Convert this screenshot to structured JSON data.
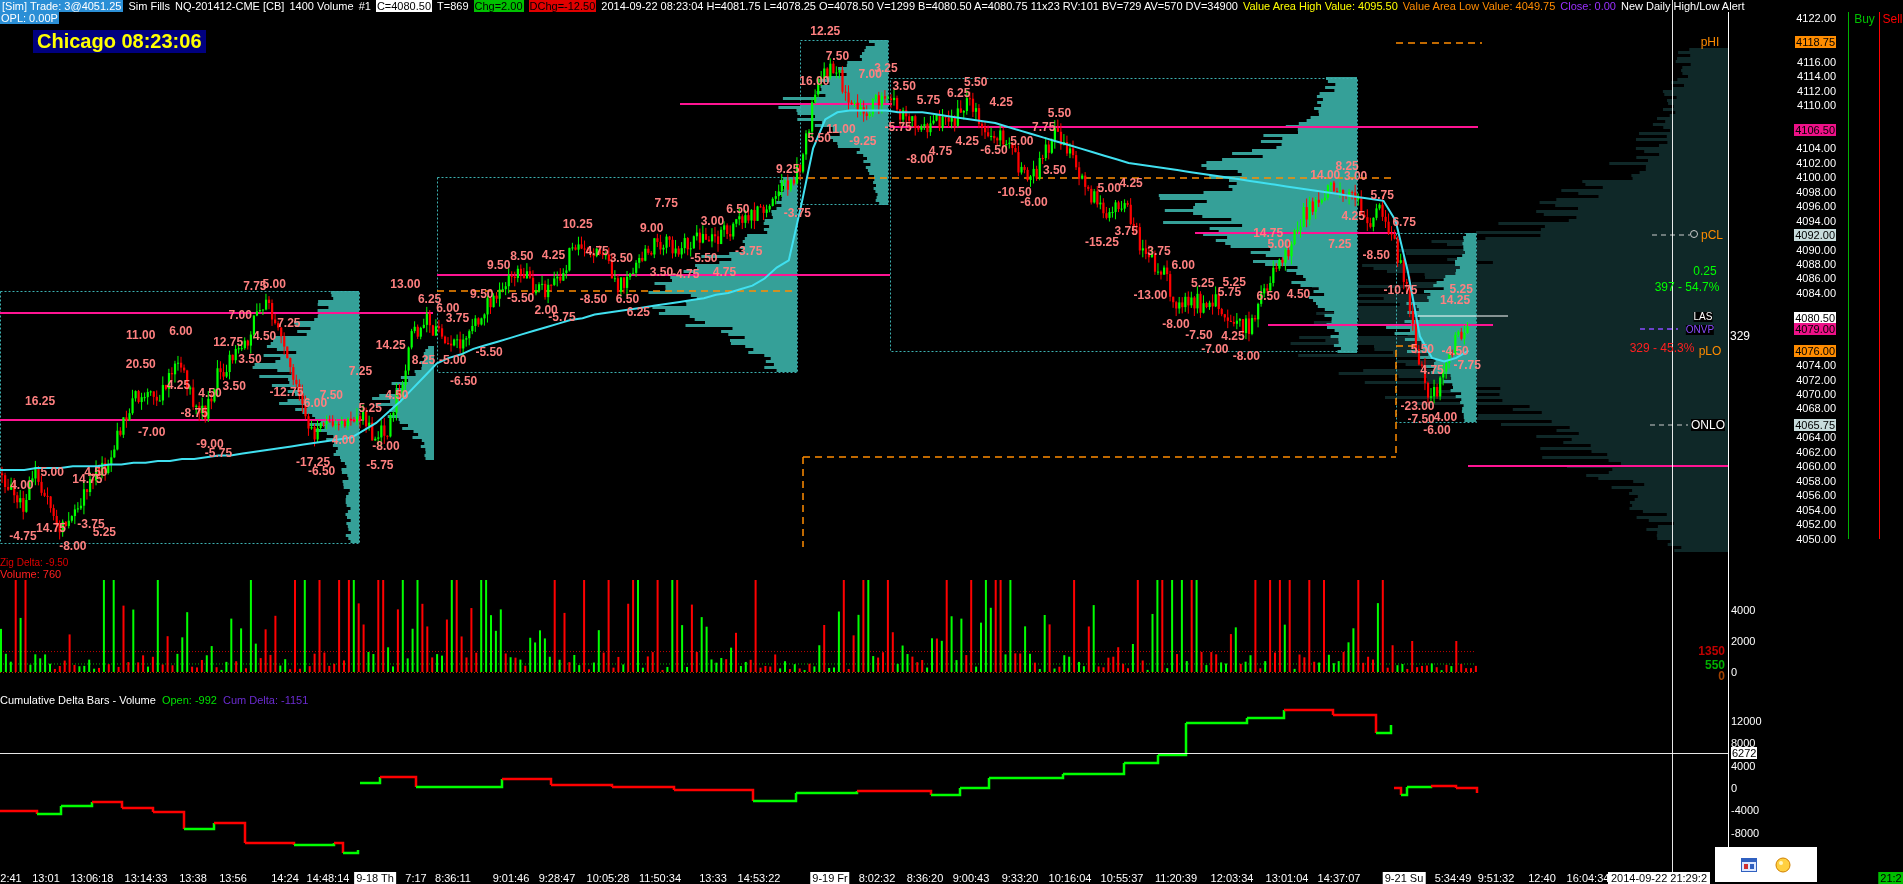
{
  "header": [
    {
      "text": "[Sim] Trade: 3@4051.25",
      "kind": "sim"
    },
    {
      "text": "Sim Fills",
      "kind": "plain"
    },
    {
      "text": "NQ-201412-CME [CB]",
      "kind": "plain"
    },
    {
      "text": "1400 Volume",
      "kind": "plain"
    },
    {
      "text": "#1",
      "kind": "plain"
    },
    {
      "text": "C=4080.50",
      "kind": "last"
    },
    {
      "text": "T=869",
      "kind": "plain"
    },
    {
      "text": "Chg=2.00",
      "kind": "up"
    },
    {
      "text": "DChg=-12.50",
      "kind": "down"
    },
    {
      "text": "2014-09-22 08:23:04 H=4081.75 L=4078.25 O=4078.50 V=1299 B=4080.50 A=4080.75 11x23 RV:101 BV=729 AV=570 DV=34900",
      "kind": "plain"
    },
    {
      "text": "Value Area High Value: 4095.50",
      "kind": "vah"
    },
    {
      "text": "Value Area Low Value: 4049.75",
      "kind": "val"
    },
    {
      "text": "Close: 0.00",
      "kind": "close"
    },
    {
      "text": "New Daily High/Low Alert",
      "kind": "plain"
    }
  ],
  "opl": "OPL: 0.00P",
  "clock": "Chicago 08:23:06",
  "dom_headers": [
    {
      "text": "Buy",
      "kind": "buy"
    },
    {
      "text": "Sell",
      "kind": "sell"
    }
  ],
  "price_chart": {
    "swing_labels": [
      "-4.75",
      "4.00",
      "5.00",
      "14.75",
      "-8.00",
      "14.75",
      "-3.75",
      "5.25",
      "4.50",
      "16.25",
      "-7.00",
      "20.50",
      "11.00",
      "6.00",
      "4.25",
      "-8.75",
      "4.50",
      "-9.00",
      "12.75",
      "-5.75",
      "3.50",
      "3.50",
      "7.00",
      "7.75",
      "5.00",
      "4.50",
      "7.25",
      "-12.75",
      "6.00",
      "7.50",
      "-17.25",
      "-6.50",
      "4.00",
      "7.25",
      "5.25",
      "-8.00",
      "-5.75",
      "4.50",
      "14.25",
      "13.00",
      "6.25",
      "6.00",
      "8.25",
      "3.75",
      "-5.00",
      "-5.50",
      "-6.50",
      "9.50",
      "9.50",
      "8.50",
      "4.25",
      "-5.50",
      "2.00",
      "-5.75",
      "10.25",
      "4.75",
      "3.50",
      "-8.50",
      "6.50",
      "6.25",
      "9.00",
      "7.75",
      "3.50",
      "-4.75",
      "-5.50",
      "3.00",
      "6.50",
      "-3.75",
      "4.75",
      "9.25",
      "-3.75",
      "12.25",
      "7.50",
      "16.00",
      "7.00",
      "3.25",
      "3.50",
      "5.50",
      "11.00",
      "-9.25",
      "-5.75",
      "-8.00",
      "5.75",
      "6.25",
      "5.50",
      "4.75",
      "4.25",
      "-6.50",
      "4.25",
      "5.00",
      "-10.50",
      "-6.00",
      "3.50",
      "5.50",
      "7.75",
      "5.00",
      "4.25",
      "3.75",
      "-15.25",
      "3.75",
      "6.00",
      "-13.00",
      "5.25",
      "5.25",
      "5.75",
      "-8.00",
      "-7.50",
      "4.25",
      "-7.00",
      "-8.00",
      "6.50",
      "4.50",
      "14.75",
      "5.00",
      "14.00",
      "8.25",
      "3.00",
      "4.25",
      "7.25",
      "5.75",
      "-8.50",
      "6.75",
      "-10.75",
      "5.25",
      "14.25",
      "5.50",
      "-4.50",
      "4.75",
      "-7.75",
      "-23.00",
      "-7.50",
      "4.00",
      "-6.00"
    ],
    "level_labels": [
      {
        "text": "pHI",
        "kind": "level"
      },
      {
        "text": "pCL",
        "kind": "level"
      },
      {
        "text": "0.25",
        "kind": "buy_stat"
      },
      {
        "text": "397 - 54.7%",
        "kind": "buy_stat"
      },
      {
        "text": "LAS",
        "kind": "last"
      },
      {
        "text": "ONVP",
        "kind": "vpoc"
      },
      {
        "text": "329 - 45.3%",
        "kind": "sell_stat"
      },
      {
        "text": "pLO",
        "kind": "level"
      },
      {
        "text": "ONLO",
        "kind": "overnight"
      },
      {
        "text": "329",
        "kind": "count"
      }
    ],
    "yticks": [
      "4122.00",
      "4116.00",
      "4114.00",
      "4112.00",
      "4110.00",
      "4104.00",
      "4102.00",
      "4100.00",
      "4098.00",
      "4096.00",
      "4094.00",
      "4090.00",
      "4088.00",
      "4086.00",
      "4084.00",
      "4074.00",
      "4072.00",
      "4070.00",
      "4068.00",
      "4064.00",
      "4062.00",
      "4060.00",
      "4058.00",
      "4056.00",
      "4054.00",
      "4052.00",
      "4050.00"
    ],
    "price_tags": [
      {
        "text": "4118.75",
        "color": "#ff8c00"
      },
      {
        "text": "4106.50",
        "color": "#ee1188"
      },
      {
        "text": "4092.00",
        "color": "#c8dcdc"
      },
      {
        "text": "4080.50",
        "color": "#ffffff"
      },
      {
        "text": "4079.00",
        "color": "#ee1188"
      },
      {
        "text": "4076.00",
        "color": "#ff8c00"
      },
      {
        "text": "4065.75",
        "color": "#c8dcdc"
      }
    ]
  },
  "volume_panel": {
    "zig_label": "Zig Delta: -9.50",
    "label": "Volume: 760",
    "axis_labels": [
      "4000",
      "2000",
      "0"
    ],
    "markers": [
      {
        "text": "1350",
        "color": "#c00000"
      },
      {
        "text": "550",
        "color": "#00b000"
      },
      {
        "text": "0",
        "color": "#a04000"
      }
    ]
  },
  "delta_panel": {
    "title": "Cumulative Delta Bars - Volume",
    "open": "Open: -992",
    "cum_delta": "Cum Delta: -1151",
    "axis_labels": [
      {
        "text": "12000",
        "kind": "tick"
      },
      {
        "text": "8000",
        "kind": "tick"
      },
      {
        "text": "6272",
        "kind": "cursor"
      },
      {
        "text": "4000",
        "kind": "tick"
      },
      {
        "text": "0",
        "kind": "tick"
      },
      {
        "text": "-4000",
        "kind": "tick"
      },
      {
        "text": "-8000",
        "kind": "tick"
      }
    ]
  },
  "time_axis": [
    {
      "text": "2:41",
      "kind": "time"
    },
    {
      "text": "13:01",
      "kind": "time"
    },
    {
      "text": "13:06:18",
      "kind": "time"
    },
    {
      "text": "13:14:33",
      "kind": "time"
    },
    {
      "text": "13:38",
      "kind": "time"
    },
    {
      "text": "13:56",
      "kind": "time"
    },
    {
      "text": "14:24",
      "kind": "time"
    },
    {
      "text": "14:48:14",
      "kind": "time"
    },
    {
      "text": "9-18 Th",
      "kind": "date"
    },
    {
      "text": "7:17",
      "kind": "time"
    },
    {
      "text": "8:36:11",
      "kind": "time"
    },
    {
      "text": "9:01:46",
      "kind": "time"
    },
    {
      "text": "9:28:47",
      "kind": "time"
    },
    {
      "text": "10:05:28",
      "kind": "time"
    },
    {
      "text": "11:50:34",
      "kind": "time"
    },
    {
      "text": "13:33",
      "kind": "time"
    },
    {
      "text": "14:53:22",
      "kind": "time"
    },
    {
      "text": "9-19 Fr",
      "kind": "date"
    },
    {
      "text": "8:02:32",
      "kind": "time"
    },
    {
      "text": "8:36:20",
      "kind": "time"
    },
    {
      "text": "9:00:43",
      "kind": "time"
    },
    {
      "text": "9:33:20",
      "kind": "time"
    },
    {
      "text": "10:16:04",
      "kind": "time"
    },
    {
      "text": "10:55:37",
      "kind": "time"
    },
    {
      "text": "11:20:39",
      "kind": "time"
    },
    {
      "text": "12:03:34",
      "kind": "time"
    },
    {
      "text": "13:01:04",
      "kind": "time"
    },
    {
      "text": "14:37:07",
      "kind": "time"
    },
    {
      "text": "9-21 Su",
      "kind": "date"
    },
    {
      "text": "5:34:49",
      "kind": "time"
    },
    {
      "text": "9:51:32",
      "kind": "time"
    },
    {
      "text": "12:40",
      "kind": "time"
    },
    {
      "text": "16:04:34",
      "kind": "time"
    },
    {
      "text": "2014-09-22 21:29:2",
      "kind": "cursor"
    },
    {
      "text": "21:2",
      "kind": "clock"
    }
  ]
}
